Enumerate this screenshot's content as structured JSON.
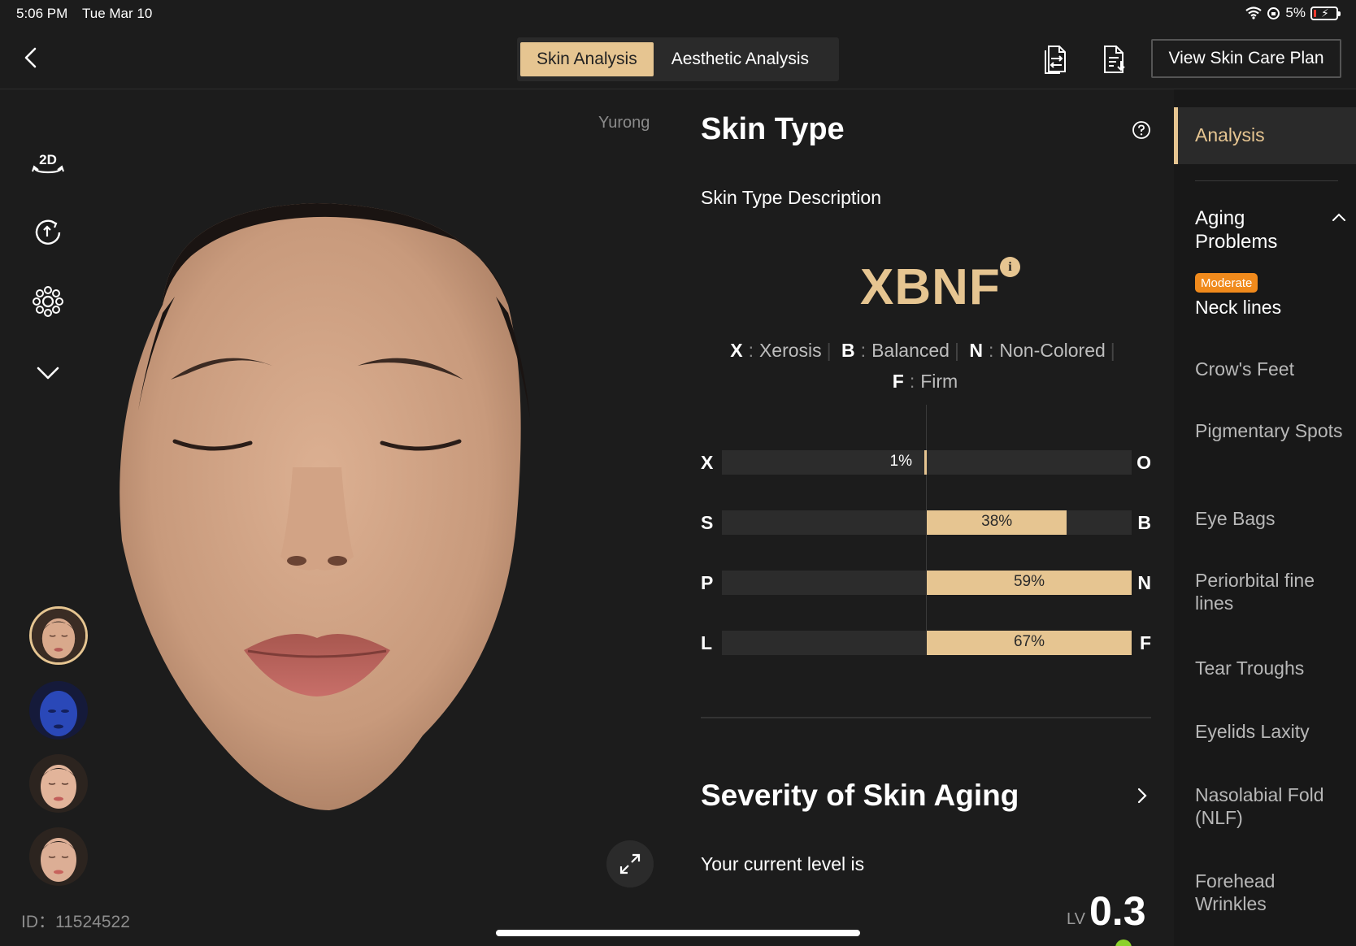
{
  "status_bar": {
    "time": "5:06 PM",
    "date": "Tue Mar 10",
    "battery": "5%"
  },
  "header": {
    "tabs": [
      {
        "label": "Skin Analysis",
        "active": true
      },
      {
        "label": "Aesthetic Analysis",
        "active": false
      }
    ],
    "plan_button": "View Skin Care Plan"
  },
  "left_rail": {
    "icons": [
      "2d-3d-toggle-icon",
      "rotate-reset-icon",
      "face-regions-icon",
      "chevron-down-icon"
    ],
    "mode_label": "2D"
  },
  "patient": {
    "name": "Yurong",
    "id_label": "ID：11524522"
  },
  "skin_type": {
    "title": "Skin Type",
    "subtitle": "Skin Type Description",
    "code": "XBNF",
    "info_icon": "i",
    "legend": [
      {
        "letter": "X",
        "meaning": "Xerosis"
      },
      {
        "letter": "B",
        "meaning": "Balanced"
      },
      {
        "letter": "N",
        "meaning": "Non-Colored"
      },
      {
        "letter": "F",
        "meaning": "Firm"
      }
    ],
    "bars": [
      {
        "left": "X",
        "right": "O",
        "value": 1,
        "label": "1%",
        "side": "left"
      },
      {
        "left": "S",
        "right": "B",
        "value": 38,
        "label": "38%",
        "side": "right"
      },
      {
        "left": "P",
        "right": "N",
        "value": 59,
        "label": "59%",
        "side": "right"
      },
      {
        "left": "L",
        "right": "F",
        "value": 67,
        "label": "67%",
        "side": "right"
      }
    ]
  },
  "severity": {
    "title": "Severity of Skin Aging",
    "current_label": "Your current level is",
    "lv_prefix": "LV",
    "level": "0.3"
  },
  "sidebar": {
    "active": "Analysis",
    "group": "Aging Problems",
    "badge": "Moderate",
    "items": [
      "Neck lines",
      "Crow's Feet",
      "Pigmentary Spots",
      "Eye Bags",
      "Periorbital fine lines",
      "Tear Troughs",
      "Eyelids Laxity",
      "Nasolabial Fold (NLF)",
      "Forehead Wrinkles"
    ]
  },
  "colors": {
    "accent": "#e6c591",
    "background": "#1c1c1c",
    "badge": "#f08a1c",
    "level_dot": "#8bd12a"
  }
}
